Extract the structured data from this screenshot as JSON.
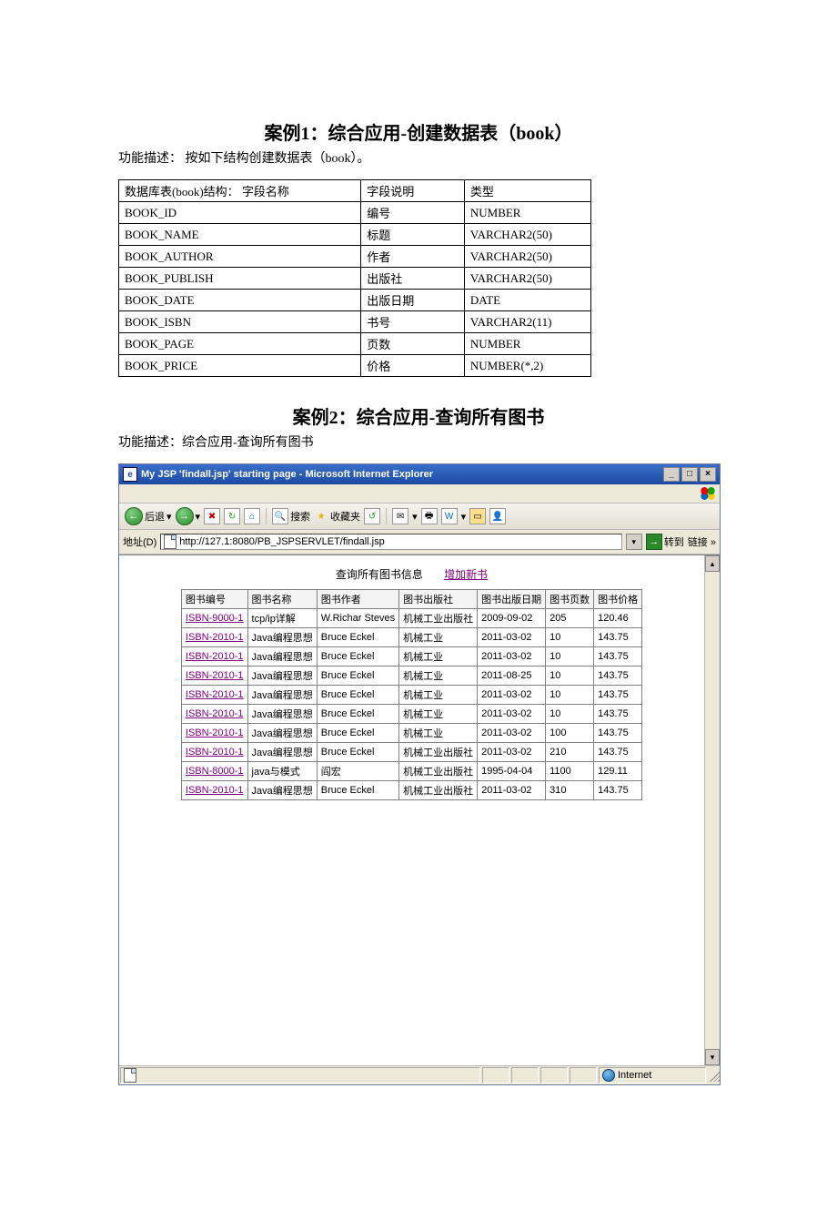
{
  "case1": {
    "title": "案例1：综合应用-创建数据表（book）",
    "desc": "功能描述：  按如下结构创建数据表（book）。",
    "header": {
      "c1": "数据库表(book)结构：  字段名称",
      "c2": "字段说明",
      "c3": "类型"
    },
    "rows": [
      {
        "c1": "BOOK_ID",
        "c2": "编号",
        "c3": "NUMBER"
      },
      {
        "c1": "BOOK_NAME",
        "c2": "标题",
        "c3": "VARCHAR2(50)"
      },
      {
        "c1": "BOOK_AUTHOR",
        "c2": "作者",
        "c3": "VARCHAR2(50)"
      },
      {
        "c1": "BOOK_PUBLISH",
        "c2": "出版社",
        "c3": "VARCHAR2(50)"
      },
      {
        "c1": "BOOK_DATE",
        "c2": "出版日期",
        "c3": "DATE"
      },
      {
        "c1": "BOOK_ISBN",
        "c2": "书号",
        "c3": "VARCHAR2(11)"
      },
      {
        "c1": "BOOK_PAGE",
        "c2": "页数",
        "c3": "NUMBER"
      },
      {
        "c1": "BOOK_PRICE",
        "c2": "价格",
        "c3": "NUMBER(*,2)"
      }
    ]
  },
  "case2": {
    "title": "案例2：综合应用-查询所有图书",
    "desc": "功能描述：综合应用-查询所有图书"
  },
  "browser": {
    "title": "My JSP 'findall.jsp' starting page - Microsoft Internet Explorer",
    "toolbar": {
      "back": "后退",
      "search": "搜索",
      "favorites": "收藏夹"
    },
    "addr": {
      "label": "地址(D)",
      "url": "http://127.1:8080/PB_JSPSERVLET/findall.jsp",
      "go": "转到",
      "links": "链接 »"
    },
    "page": {
      "heading": "查询所有图书信息",
      "addlink": "增加新书",
      "headers": [
        "图书编号",
        "图书名称",
        "图书作者",
        "图书出版社",
        "图书出版日期",
        "图书页数",
        "图书价格"
      ],
      "rows": [
        {
          "id": "ISBN-9000-1",
          "name": "tcp/ip详解",
          "author": "W.Richar Steves",
          "pub": "机械工业出版社",
          "date": "2009-09-02",
          "page": "205",
          "price": "120.46"
        },
        {
          "id": "ISBN-2010-1",
          "name": "Java编程思想",
          "author": "Bruce Eckel",
          "pub": "机械工业",
          "date": "2011-03-02",
          "page": "10",
          "price": "143.75"
        },
        {
          "id": "ISBN-2010-1",
          "name": "Java编程思想",
          "author": "Bruce Eckel",
          "pub": "机械工业",
          "date": "2011-03-02",
          "page": "10",
          "price": "143.75"
        },
        {
          "id": "ISBN-2010-1",
          "name": "Java编程思想",
          "author": "Bruce Eckel",
          "pub": "机械工业",
          "date": "2011-08-25",
          "page": "10",
          "price": "143.75"
        },
        {
          "id": "ISBN-2010-1",
          "name": "Java编程思想",
          "author": "Bruce Eckel",
          "pub": "机械工业",
          "date": "2011-03-02",
          "page": "10",
          "price": "143.75"
        },
        {
          "id": "ISBN-2010-1",
          "name": "Java编程思想",
          "author": "Bruce Eckel",
          "pub": "机械工业",
          "date": "2011-03-02",
          "page": "10",
          "price": "143.75"
        },
        {
          "id": "ISBN-2010-1",
          "name": "Java编程思想",
          "author": "Bruce Eckel",
          "pub": "机械工业",
          "date": "2011-03-02",
          "page": "100",
          "price": "143.75"
        },
        {
          "id": "ISBN-2010-1",
          "name": "Java编程思想",
          "author": "Bruce Eckel",
          "pub": "机械工业出版社",
          "date": "2011-03-02",
          "page": "210",
          "price": "143.75"
        },
        {
          "id": "ISBN-8000-1",
          "name": "java与模式",
          "author": "阎宏",
          "pub": "机械工业出版社",
          "date": "1995-04-04",
          "page": "1100",
          "price": "129.11"
        },
        {
          "id": "ISBN-2010-1",
          "name": "Java编程思想",
          "author": "Bruce Eckel",
          "pub": "机械工业出版社",
          "date": "2011-03-02",
          "page": "310",
          "price": "143.75"
        }
      ]
    },
    "status": {
      "zone": "Internet"
    }
  }
}
